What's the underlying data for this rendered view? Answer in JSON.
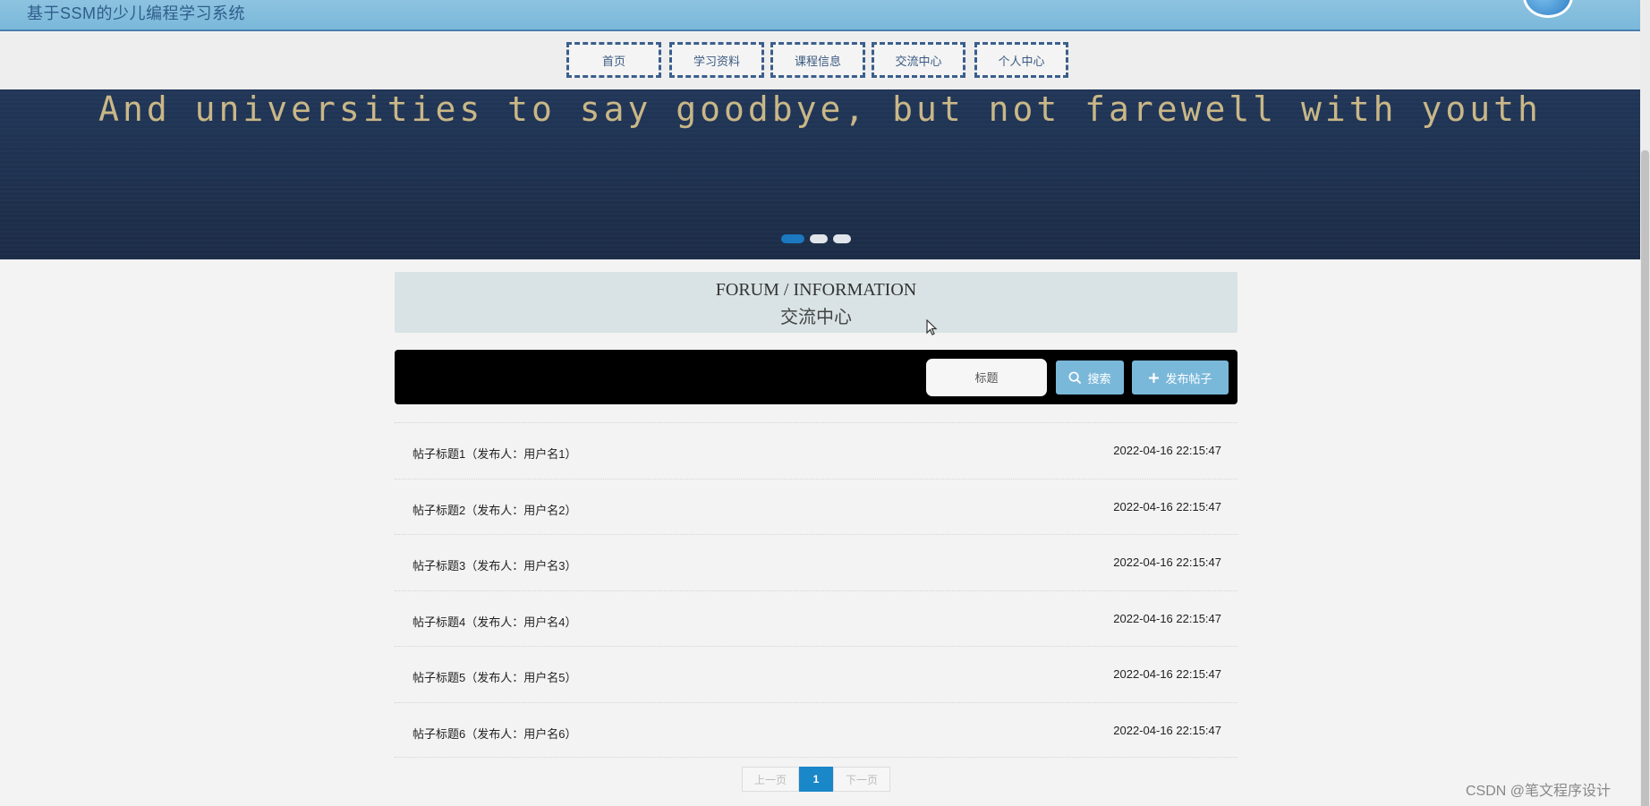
{
  "header": {
    "site_title": "基于SSM的少儿编程学习系统"
  },
  "nav": {
    "items": [
      "首页",
      "学习资料",
      "课程信息",
      "交流中心",
      "个人中心"
    ]
  },
  "banner": {
    "text": "And universities to say goodbye, but not farewell with youth"
  },
  "section": {
    "title_en": "FORUM / INFORMATION",
    "title_cn": "交流中心"
  },
  "search": {
    "placeholder": "标题",
    "search_label": "搜索",
    "post_label": "发布帖子"
  },
  "posts": [
    {
      "title": "帖子标题1（发布人：用户名1）",
      "date": "2022-04-16 22:15:47"
    },
    {
      "title": "帖子标题2（发布人：用户名2）",
      "date": "2022-04-16 22:15:47"
    },
    {
      "title": "帖子标题3（发布人：用户名3）",
      "date": "2022-04-16 22:15:47"
    },
    {
      "title": "帖子标题4（发布人：用户名4）",
      "date": "2022-04-16 22:15:47"
    },
    {
      "title": "帖子标题5（发布人：用户名5）",
      "date": "2022-04-16 22:15:47"
    },
    {
      "title": "帖子标题6（发布人：用户名6）",
      "date": "2022-04-16 22:15:47"
    }
  ],
  "pagination": {
    "prev": "上一页",
    "current": "1",
    "next": "下一页"
  },
  "watermark": "CSDN @笔文程序设计",
  "colors": {
    "accent": "#7ab8da",
    "header": "#8dc3e0",
    "nav_border": "#3b5f8d",
    "page_active": "#1a87c9"
  }
}
